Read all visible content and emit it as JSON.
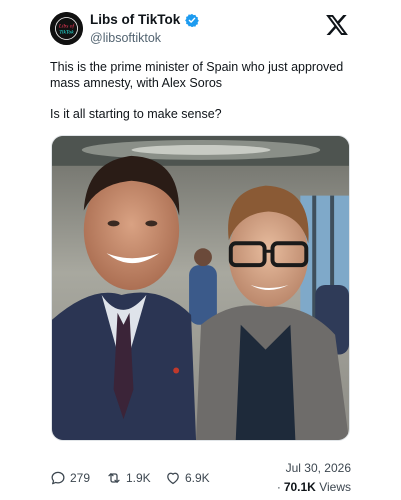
{
  "author": {
    "display_name": "Libs of TikTok",
    "handle": "@libsoftiktok",
    "verified": true,
    "avatar_text": "Libs of TikTok"
  },
  "platform": {
    "logo_icon": "x-logo-icon"
  },
  "tweet": {
    "line1": "This is the prime minister of Spain who just approved mass amnesty, with Alex Soros",
    "line2": "Is it all starting to make sense?",
    "image_icon": "photo-two-men-selfie"
  },
  "actions": {
    "replies": "279",
    "retweets": "1.9K",
    "likes": "6.9K"
  },
  "meta": {
    "date": "Jul 30, 2026",
    "separator": "·",
    "views_count": "70.1K",
    "views_label": "Views"
  },
  "colors": {
    "text_primary": "#0f1419",
    "text_secondary": "#536471",
    "verified_blue": "#1d9bf0"
  }
}
